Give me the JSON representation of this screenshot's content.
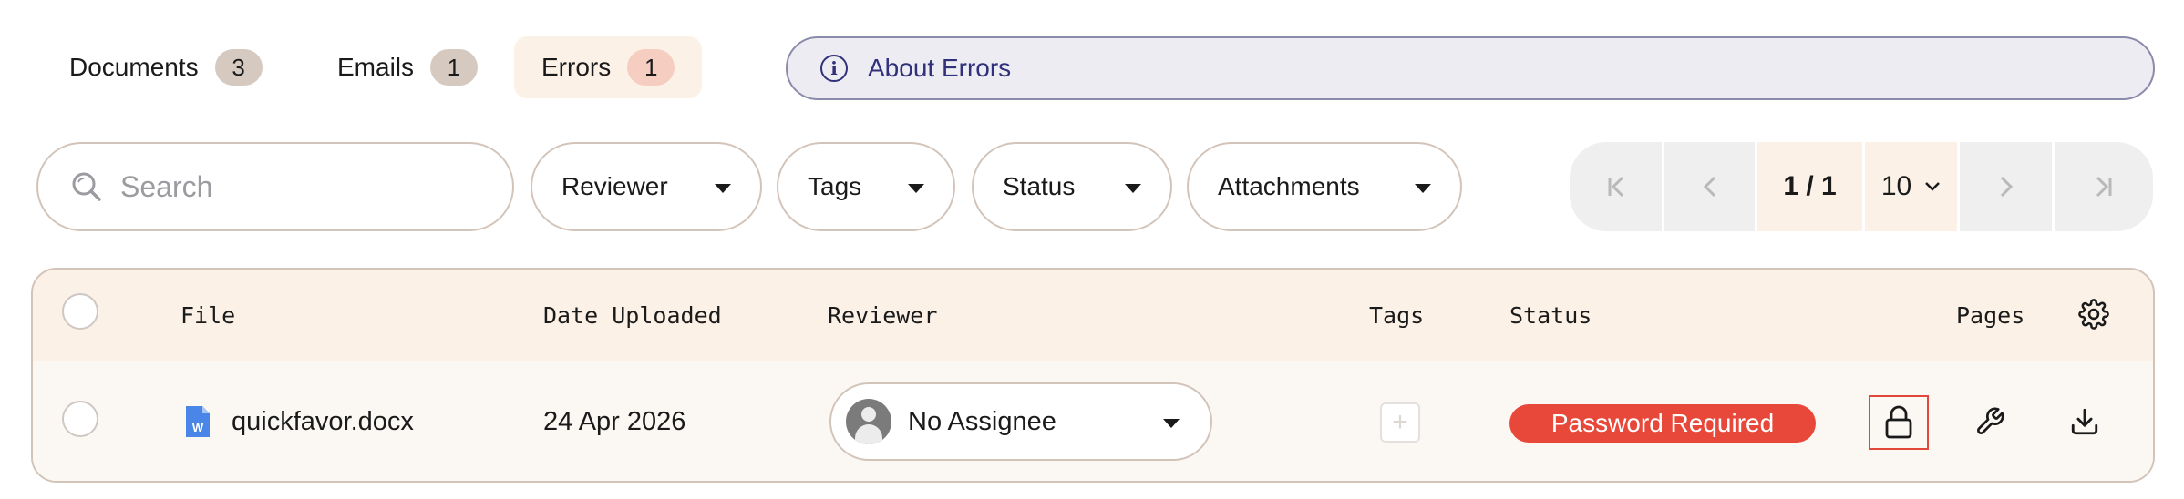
{
  "tabs": [
    {
      "label": "Documents",
      "count": "3"
    },
    {
      "label": "Emails",
      "count": "1"
    },
    {
      "label": "Errors",
      "count": "1"
    }
  ],
  "about": {
    "label": "About Errors",
    "icon": "info-icon"
  },
  "search": {
    "placeholder": "Search",
    "icon": "search-icon"
  },
  "filters": {
    "reviewer": "Reviewer",
    "tags": "Tags",
    "status": "Status",
    "attachments": "Attachments"
  },
  "pager": {
    "page": "1 / 1",
    "page_size": "10"
  },
  "table": {
    "headers": {
      "file": "File",
      "date": "Date Uploaded",
      "reviewer": "Reviewer",
      "tags": "Tags",
      "status": "Status",
      "pages": "Pages"
    },
    "rows": [
      {
        "file": "quickfavor.docx",
        "file_icon": "word-document-icon",
        "date": "24 Apr 2026",
        "reviewer": "No Assignee",
        "status": "Password Required"
      }
    ]
  },
  "colors": {
    "accent_bg": "#fbf1e6",
    "status_error": "#e8483a",
    "about_text": "#30317a",
    "word_blue": "#4a86e8"
  }
}
